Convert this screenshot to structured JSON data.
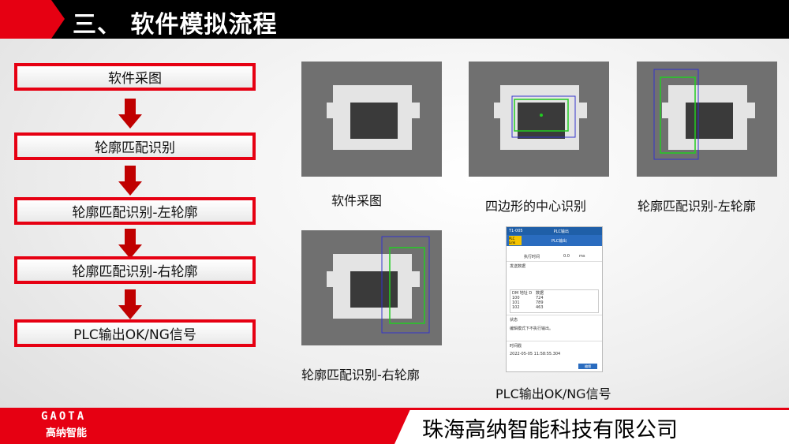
{
  "header": {
    "title": "三、 软件模拟流程"
  },
  "steps": [
    "软件采图",
    "轮廓匹配识别",
    "轮廓匹配识别-左轮廓",
    "轮廓匹配识别-右轮廓",
    "PLC输出OK/NG信号"
  ],
  "captions": {
    "capture": "软件采图",
    "quad_center": "四边形的中心识别",
    "left_contour": "轮廓匹配识别-左轮廓",
    "right_contour": "轮廓匹配识别-右轮廓",
    "plc_output": "PLC输出OK/NG信号"
  },
  "plc_screen": {
    "device": "T1-005",
    "title": "PLC输出",
    "subtitle": "PLC输出",
    "badge": "PLC Link",
    "exec_time_label": "执行时间",
    "exec_time_value": "0.0",
    "exec_time_unit": "ms",
    "send_data_label": "发送数据",
    "table_headers": [
      "DM 地址 D",
      "数据"
    ],
    "table_rows": [
      [
        "100",
        "724"
      ],
      [
        "101",
        "789"
      ],
      [
        "102",
        "463"
      ]
    ],
    "status_label": "状态",
    "status_text": "编辑模式下不执行输出。",
    "time_label": "时间戳",
    "timestamp": "2022-05-05 11:58:55.304",
    "edit_button": "编辑"
  },
  "footer": {
    "logo_latin": "GAOTA",
    "logo_cn": "高纳智能",
    "company": "珠海高纳智能科技有限公司"
  },
  "colors": {
    "accent": "#e60012",
    "header": "#000000",
    "arrow": "#c00000",
    "overlay_green": "#22cc22",
    "overlay_blue": "#3333cc"
  }
}
